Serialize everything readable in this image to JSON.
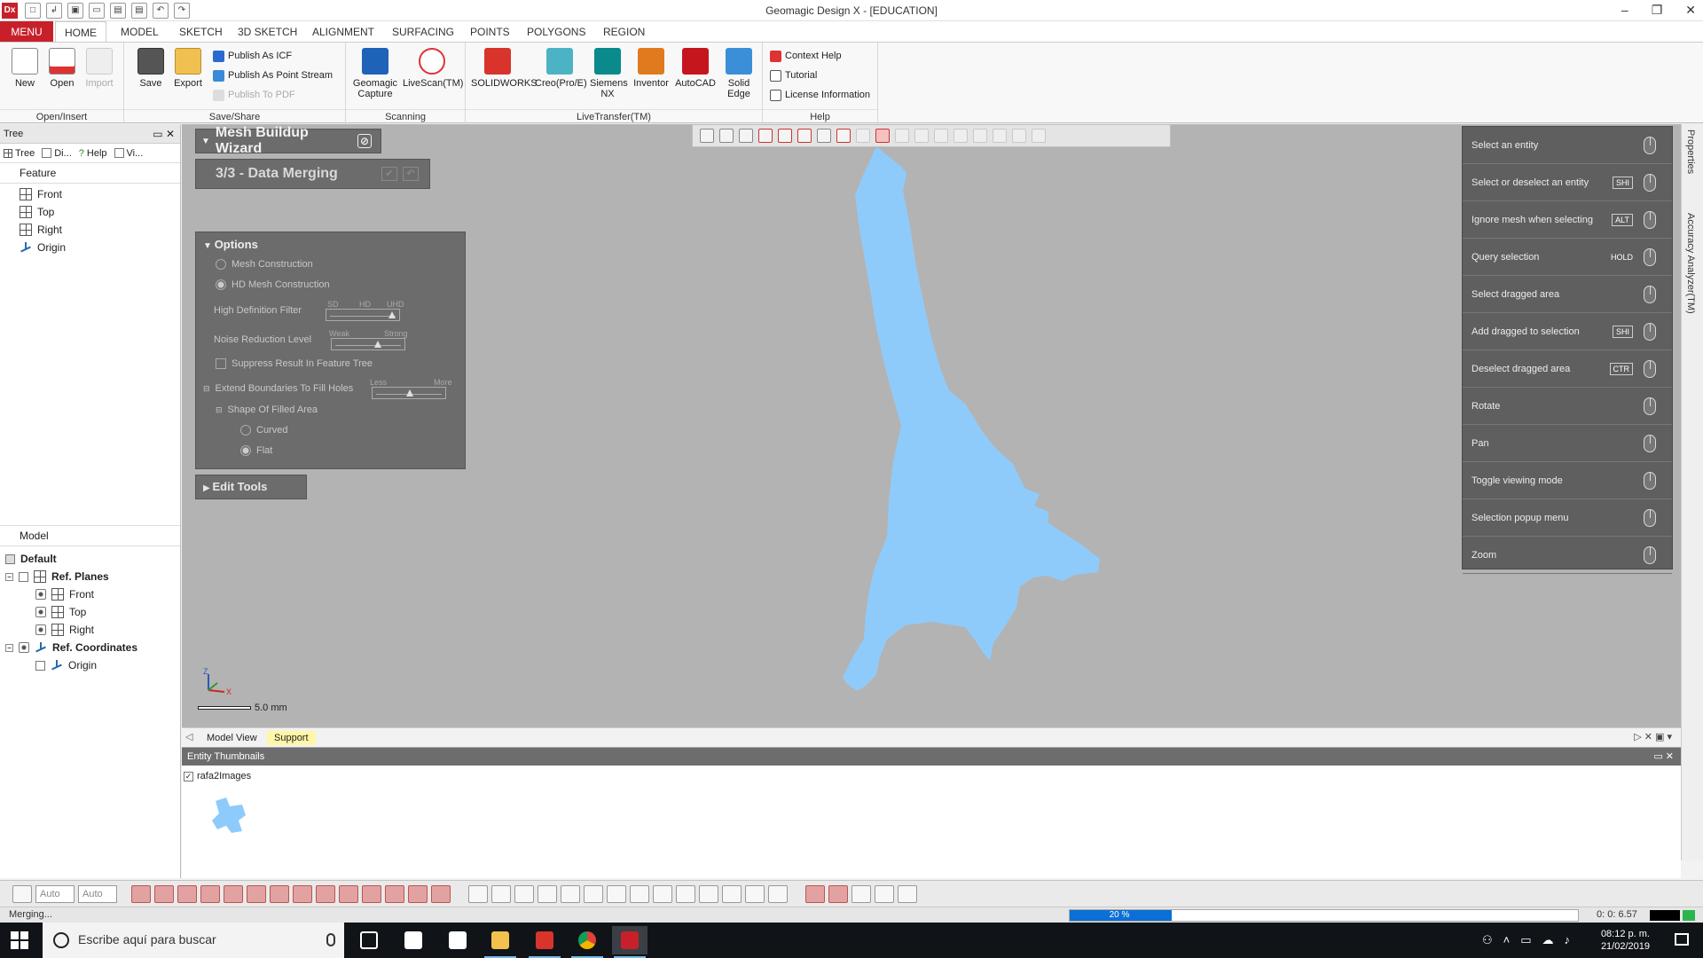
{
  "window": {
    "title": "Geomagic Design X - [EDUCATION]",
    "app_icon_text": "Dx",
    "controls": [
      "–",
      "❐",
      "✕"
    ]
  },
  "ribbon": {
    "tabs": [
      "MENU",
      "HOME",
      "MODEL",
      "SKETCH",
      "3D SKETCH",
      "ALIGNMENT",
      "SURFACING",
      "POINTS",
      "POLYGONS",
      "REGION"
    ],
    "active_tab": "HOME",
    "groups": {
      "open_insert": {
        "label": "Open/Insert",
        "new": "New",
        "open": "Open",
        "import": "Import"
      },
      "save_share": {
        "label": "Save/Share",
        "save": "Save",
        "export": "Export",
        "publish_icf": "Publish As ICF",
        "publish_point_stream": "Publish As Point Stream",
        "publish_pdf": "Publish To PDF"
      },
      "scanning": {
        "label": "Scanning",
        "geomagic_capture": "Geomagic Capture",
        "livescan": "LiveScan(TM)"
      },
      "livetransfer": {
        "label": "LiveTransfer(TM)",
        "solidworks": "SOLIDWORKS",
        "creo": "Creo(Pro/E)",
        "siemens_nx": "Siemens NX",
        "inventor": "Inventor",
        "autocad": "AutoCAD",
        "solid_edge": "Solid Edge"
      },
      "help": {
        "label": "Help",
        "context_help": "Context Help",
        "tutorial": "Tutorial",
        "license_information": "License Information"
      }
    }
  },
  "left_panel": {
    "title": "Tree",
    "subtabs": [
      "Tree",
      "Di...",
      "Help",
      "Vi..."
    ],
    "feature_title": "Feature",
    "feature_items": [
      "Front",
      "Top",
      "Right",
      "Origin"
    ],
    "model_title": "Model",
    "model_tree": {
      "default": "Default",
      "ref_planes": "Ref. Planes",
      "planes": [
        "Front",
        "Top",
        "Right"
      ],
      "ref_coordinates": "Ref. Coordinates",
      "origin": "Origin"
    }
  },
  "wizard": {
    "title": "Mesh Buildup Wizard",
    "step": "3/3 - Data Merging",
    "options_title": "Options",
    "mesh_construction": "Mesh Construction",
    "hd_mesh_construction": "HD Mesh Construction",
    "high_definition_filter": "High Definition Filter",
    "hd_filter_marks": [
      "SD",
      "HD",
      "UHD"
    ],
    "noise_reduction_level": "Noise Reduction Level",
    "noise_marks": [
      "Weak",
      "Strong"
    ],
    "suppress_result": "Suppress Result In Feature Tree",
    "extend_boundaries": "Extend Boundaries To Fill Holes",
    "extend_marks": [
      "Less",
      "More"
    ],
    "shape_of_filled_area": "Shape Of Filled Area",
    "curved": "Curved",
    "flat": "Flat",
    "edit_tools": "Edit Tools"
  },
  "mouse_help": [
    {
      "label": "Select an entity",
      "key": ""
    },
    {
      "label": "Select or deselect an entity",
      "key": "SHI"
    },
    {
      "label": "Ignore mesh when selecting",
      "key": "ALT"
    },
    {
      "label": "Query selection",
      "key": "HOLD"
    },
    {
      "label": "Select dragged area",
      "key": ""
    },
    {
      "label": "Add dragged to selection",
      "key": "SHI"
    },
    {
      "label": "Deselect dragged area",
      "key": "CTR"
    },
    {
      "label": "Rotate",
      "key": ""
    },
    {
      "label": "Pan",
      "key": ""
    },
    {
      "label": "Toggle viewing mode",
      "key": ""
    },
    {
      "label": "Selection popup menu",
      "key": ""
    },
    {
      "label": "Zoom",
      "key": ""
    }
  ],
  "viewport": {
    "scale_label": "5.0 mm",
    "axis_z": "Z",
    "axis_x": "X",
    "mesh_color": "#8fcbfa",
    "background_color": "#b3b3b3"
  },
  "right_tabs": [
    "Properties",
    "Accuracy Analyzer(TM)"
  ],
  "view_tabs": [
    "Model View",
    "Support"
  ],
  "thumbnails": {
    "title": "Entity Thumbnails",
    "item_label": "rafa2Images"
  },
  "bottom_toolbar": {
    "combo1": "Auto",
    "combo2": "Auto"
  },
  "status": {
    "message": "Merging...",
    "progress_percent": 20,
    "progress_label": "20 %",
    "timer": "0: 0: 6.57"
  },
  "taskbar": {
    "search_placeholder": "Escribe aquí para buscar",
    "time": "08:12 p. m.",
    "date": "21/02/2019"
  }
}
